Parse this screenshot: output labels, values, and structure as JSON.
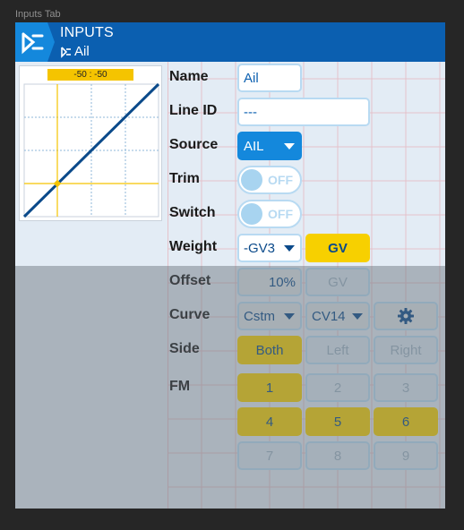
{
  "window": {
    "caption": "Inputs Tab"
  },
  "header": {
    "title": "INPUTS",
    "subtitle": "Ail"
  },
  "graph": {
    "label": "-50 : -50"
  },
  "rows": {
    "name": {
      "label": "Name",
      "value": "Ail"
    },
    "line_id": {
      "label": "Line ID",
      "value": "---"
    },
    "source": {
      "label": "Source",
      "value": "AIL"
    },
    "trim": {
      "label": "Trim",
      "state": "OFF"
    },
    "switch": {
      "label": "Switch",
      "state": "OFF"
    },
    "weight": {
      "label": "Weight",
      "value": "-GV3",
      "gv": "GV"
    },
    "offset": {
      "label": "Offset",
      "value": "10%",
      "gv": "GV"
    },
    "curve": {
      "label": "Curve",
      "type": "Cstm",
      "value": "CV14"
    },
    "side": {
      "label": "Side",
      "options": [
        "Both",
        "Left",
        "Right"
      ]
    },
    "fm": {
      "label": "FM",
      "modes": [
        "1",
        "2",
        "3",
        "4",
        "5",
        "6",
        "7",
        "8",
        "9"
      ]
    }
  },
  "colors": {
    "header": "#0b5fb0",
    "active": "#f7d000",
    "source": "#1488dc"
  },
  "icons": {
    "logo": "inputs-logo-icon",
    "sub": "input-mix-icon",
    "settings": "gear-icon"
  }
}
